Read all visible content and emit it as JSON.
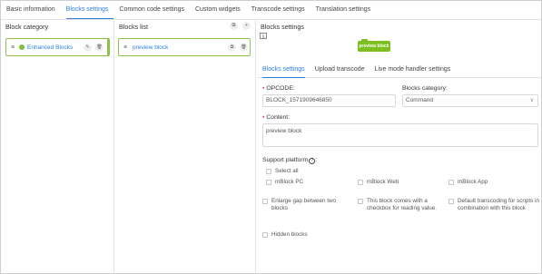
{
  "tabs": [
    "Basic information",
    "Blocks settings",
    "Common code settings",
    "Custom widgets",
    "Transcode settings",
    "Translation settings"
  ],
  "category": {
    "title": "Block category",
    "item_label": "Enhanced Blocks"
  },
  "blocks_list": {
    "title": "Blocks list",
    "item_label": "preview block"
  },
  "settings": {
    "title": "Blocks settings",
    "preview_text": "preview block",
    "sub_tabs": [
      "Blocks settings",
      "Upload transcode",
      "Live mode handler settings"
    ],
    "opcode_label": "OPCODE:",
    "opcode_value": "BLOCK_1571909646850",
    "category_label": "Blocks category:",
    "category_value": "Command",
    "content_label": "Content:",
    "content_value": "preview block",
    "platform_label": "Support platform",
    "select_all": "Select all",
    "platforms": [
      "mBlock PC",
      "mBlock Web",
      "mBlock App"
    ],
    "options": [
      "Enlarge gap between two blocks",
      "This block comes with a checkbox for reading value.",
      "Default transcoding for scripts in combination with this block"
    ],
    "hidden_blocks": "Hidden blocks"
  },
  "colors": {
    "accent": "#2f7de1",
    "block_green": "#7cbf1f",
    "border_green": "#8bc34a",
    "required": "#e53935"
  }
}
